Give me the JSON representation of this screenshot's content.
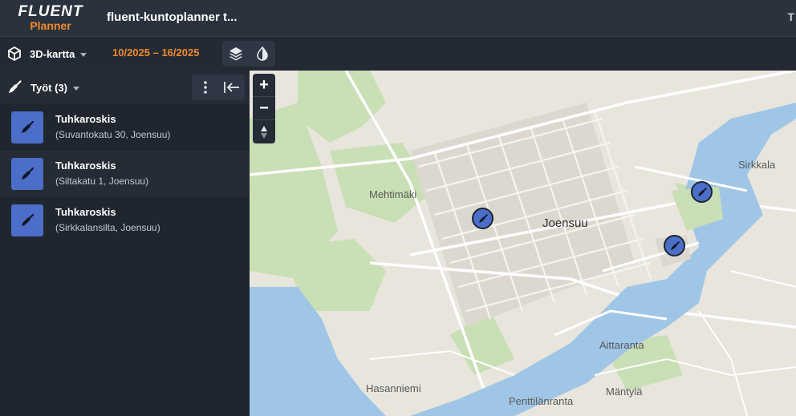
{
  "header": {
    "logo_top": "FLUENT",
    "logo_bottom": "Planner",
    "title": "fluent-kuntoplanner t...",
    "right_text": "T"
  },
  "toolbar": {
    "map_mode": "3D-kartta",
    "week_range": "10/2025 – 16/2025",
    "icons": [
      "cube-icon",
      "layers-icon",
      "contrast-icon"
    ]
  },
  "sidebar": {
    "jobs_label": "Työt (3)",
    "actions": [
      "more-vertical-icon",
      "collapse-left-icon"
    ],
    "jobs": [
      {
        "title": "Tuhkaroskis",
        "address": "(Suvantokatu 30, Joensuu)"
      },
      {
        "title": "Tuhkaroskis",
        "address": "(Siltakatu 1, Joensuu)"
      },
      {
        "title": "Tuhkaroskis",
        "address": "(Sirkkalansilta, Joensuu)"
      }
    ]
  },
  "map": {
    "zoom_in": "+",
    "zoom_out": "−",
    "compass": "⬍",
    "labels": {
      "sirkkala": "Sirkkala",
      "mehtimaki": "Mehtimäki",
      "joensuu": "Joensuu",
      "aittaranta": "Aittaranta",
      "hasanniemi": "Hasanniemi",
      "penttilanranta": "Penttilänranta",
      "mantyla": "Mäntylä"
    },
    "colors": {
      "water": "#9fc6e6",
      "park": "#c9dfb5",
      "land": "#e8e5dd",
      "block": "#dcd8cf",
      "marker": "#4b6fc9"
    }
  }
}
